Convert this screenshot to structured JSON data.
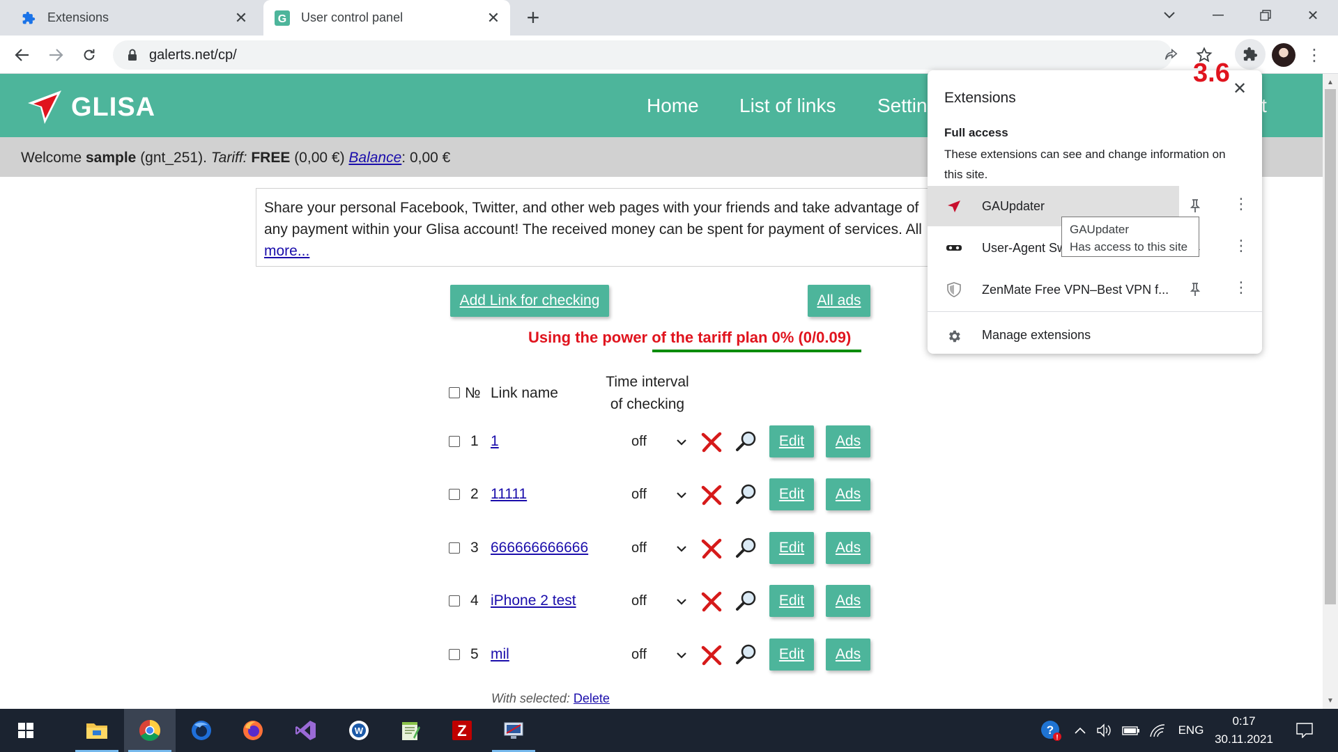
{
  "browser": {
    "tabs": [
      {
        "title": "Extensions",
        "icon": "puzzle-icon",
        "active": false
      },
      {
        "title": "User control panel",
        "icon": "glisa-favicon",
        "active": true
      }
    ],
    "url": "galerts.net/cp/"
  },
  "site": {
    "logo_text": "GLISA",
    "nav": [
      "Home",
      "List of links",
      "Settin",
      "t"
    ],
    "welcome": {
      "prefix": "Welcome ",
      "user": "sample",
      "id": " (gnt_251). ",
      "tariff_label": "Tariff:",
      "tariff_value": " FREE",
      "tariff_price": " (0,00 €) ",
      "balance_label": "Balance",
      "balance_value": ": 0,00 €"
    },
    "promo": {
      "line1": "Share your personal Facebook, Twitter, and other web pages with your friends and take advantage of",
      "line2": "any payment within your Glisa account! The received money can be spent for payment of services. All",
      "more": "more..."
    },
    "add_link_button": "Add Link for checking",
    "all_ads_button": "All ads",
    "usage_text": "Using the power of the tariff plan 0% (0/0.09)",
    "table": {
      "col_num": "№",
      "col_name": "Link name",
      "col_interval_1": "Time interval",
      "col_interval_2": "of checking",
      "edit_label": "Edit",
      "ads_label": "Ads",
      "rows": [
        {
          "num": "1",
          "name": "1",
          "interval": "off"
        },
        {
          "num": "2",
          "name": "11111",
          "interval": "off"
        },
        {
          "num": "3",
          "name": "666666666666",
          "interval": "off"
        },
        {
          "num": "4",
          "name": "iPhone 2 test",
          "interval": "off"
        },
        {
          "num": "5",
          "name": "mil",
          "interval": "off"
        }
      ]
    },
    "with_selected": "With selected:",
    "delete_label": "Delete"
  },
  "extensions_popup": {
    "title": "Extensions",
    "section": "Full access",
    "description": "These extensions can see and change information on this site.",
    "items": [
      {
        "name": "GAUpdater",
        "icon": "gaupdater-icon"
      },
      {
        "name": "User-Agent Sw",
        "icon": "user-agent-switcher-icon"
      },
      {
        "name": "ZenMate Free VPN–Best VPN f...",
        "icon": "zenmate-shield-icon"
      }
    ],
    "manage": "Manage extensions",
    "tooltip_title": "GAUpdater",
    "tooltip_text": "Has access to this site",
    "version_badge": "3.6"
  },
  "taskbar": {
    "language": "ENG",
    "time": "0:17",
    "date": "30.11.2021"
  },
  "colors": {
    "brand_green": "#4db59b",
    "alert_red": "#e0141e",
    "usage_bar_green": "#0b8c0b"
  }
}
